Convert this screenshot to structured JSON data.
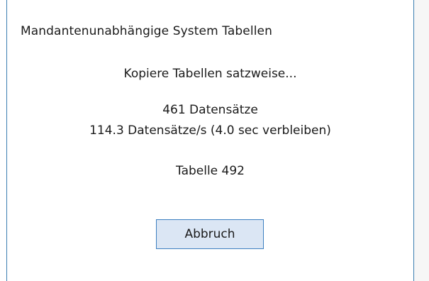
{
  "dialog": {
    "title": "Mandantenunabhängige System Tabellen",
    "status_text": "Kopiere Tabellen satzweise...",
    "records_text": "461 Datensätze",
    "rate_text": "114.3 Datensätze/s (4.0 sec verbleiben)",
    "table_text": "Tabelle 492",
    "cancel_label": "Abbruch"
  },
  "colors": {
    "border": "#3c7fb1",
    "button_bg": "#dbe6f4",
    "button_border": "#3c7fc0",
    "text": "#1a1a1a"
  }
}
